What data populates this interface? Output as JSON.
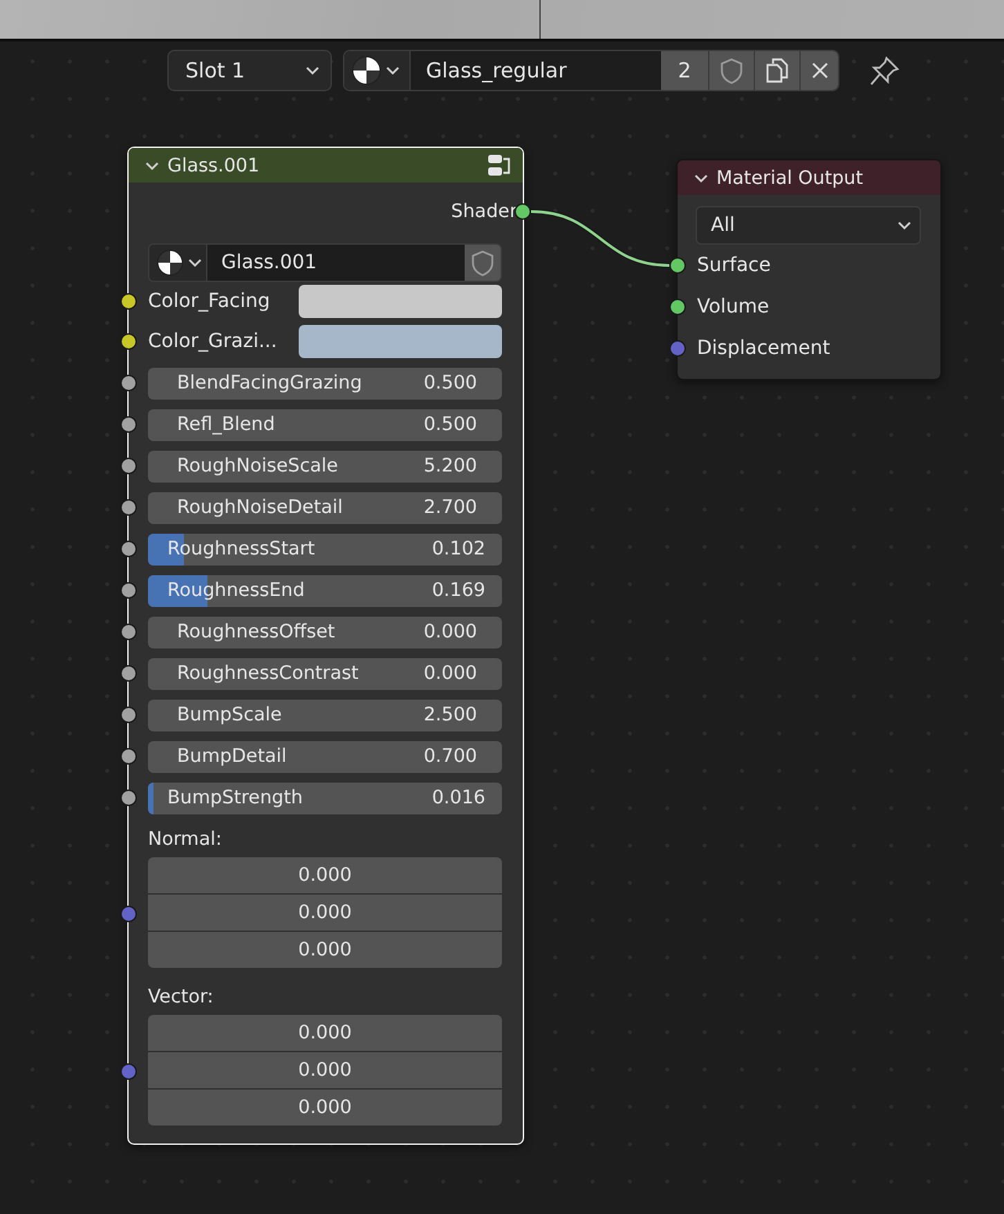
{
  "header": {
    "slot": "Slot 1",
    "material": "Glass_regular",
    "users": "2"
  },
  "nodes": [
    {
      "kind": "group",
      "title": "Glass.001",
      "selected": true,
      "outputs": [
        {
          "kind": "shader",
          "label": "Shader"
        }
      ],
      "datablock": "Glass.001",
      "inputs": [
        {
          "kind": "color",
          "label": "Color_Facing",
          "color": "#c8c8c8"
        },
        {
          "kind": "color",
          "label": "Color_Grazi...",
          "color": "#a5b7c8"
        },
        {
          "kind": "number",
          "label": "BlendFacingGrazing",
          "value": "0.500"
        },
        {
          "kind": "number",
          "label": "Refl_Blend",
          "value": "0.500"
        },
        {
          "kind": "number",
          "label": "RoughNoiseScale",
          "value": "5.200"
        },
        {
          "kind": "number",
          "label": "RoughNoiseDetail",
          "value": "2.700"
        },
        {
          "kind": "slider",
          "label": "RoughnessStart",
          "value": "0.102",
          "level": 0.102
        },
        {
          "kind": "slider",
          "label": "RoughnessEnd",
          "value": "0.169",
          "level": 0.169
        },
        {
          "kind": "number",
          "label": "RoughnessOffset",
          "value": "0.000"
        },
        {
          "kind": "number",
          "label": "RoughnessContrast",
          "value": "0.000"
        },
        {
          "kind": "number",
          "label": "BumpScale",
          "value": "2.500"
        },
        {
          "kind": "number",
          "label": "BumpDetail",
          "value": "0.700"
        },
        {
          "kind": "slider",
          "label": "BumpStrength",
          "value": "0.016",
          "level": 0.016
        },
        {
          "kind": "vector",
          "label": "Normal:",
          "values": [
            "0.000",
            "0.000",
            "0.000"
          ]
        },
        {
          "kind": "vector",
          "label": "Vector:",
          "values": [
            "0.000",
            "0.000",
            "0.000"
          ]
        }
      ]
    },
    {
      "kind": "output",
      "title": "Material Output",
      "selected": false,
      "target": "All",
      "inputs": [
        {
          "kind": "shader",
          "label": "Surface",
          "linked": true
        },
        {
          "kind": "shader",
          "label": "Volume",
          "linked": false
        },
        {
          "kind": "vector",
          "label": "Displacement",
          "linked": false
        }
      ]
    }
  ]
}
